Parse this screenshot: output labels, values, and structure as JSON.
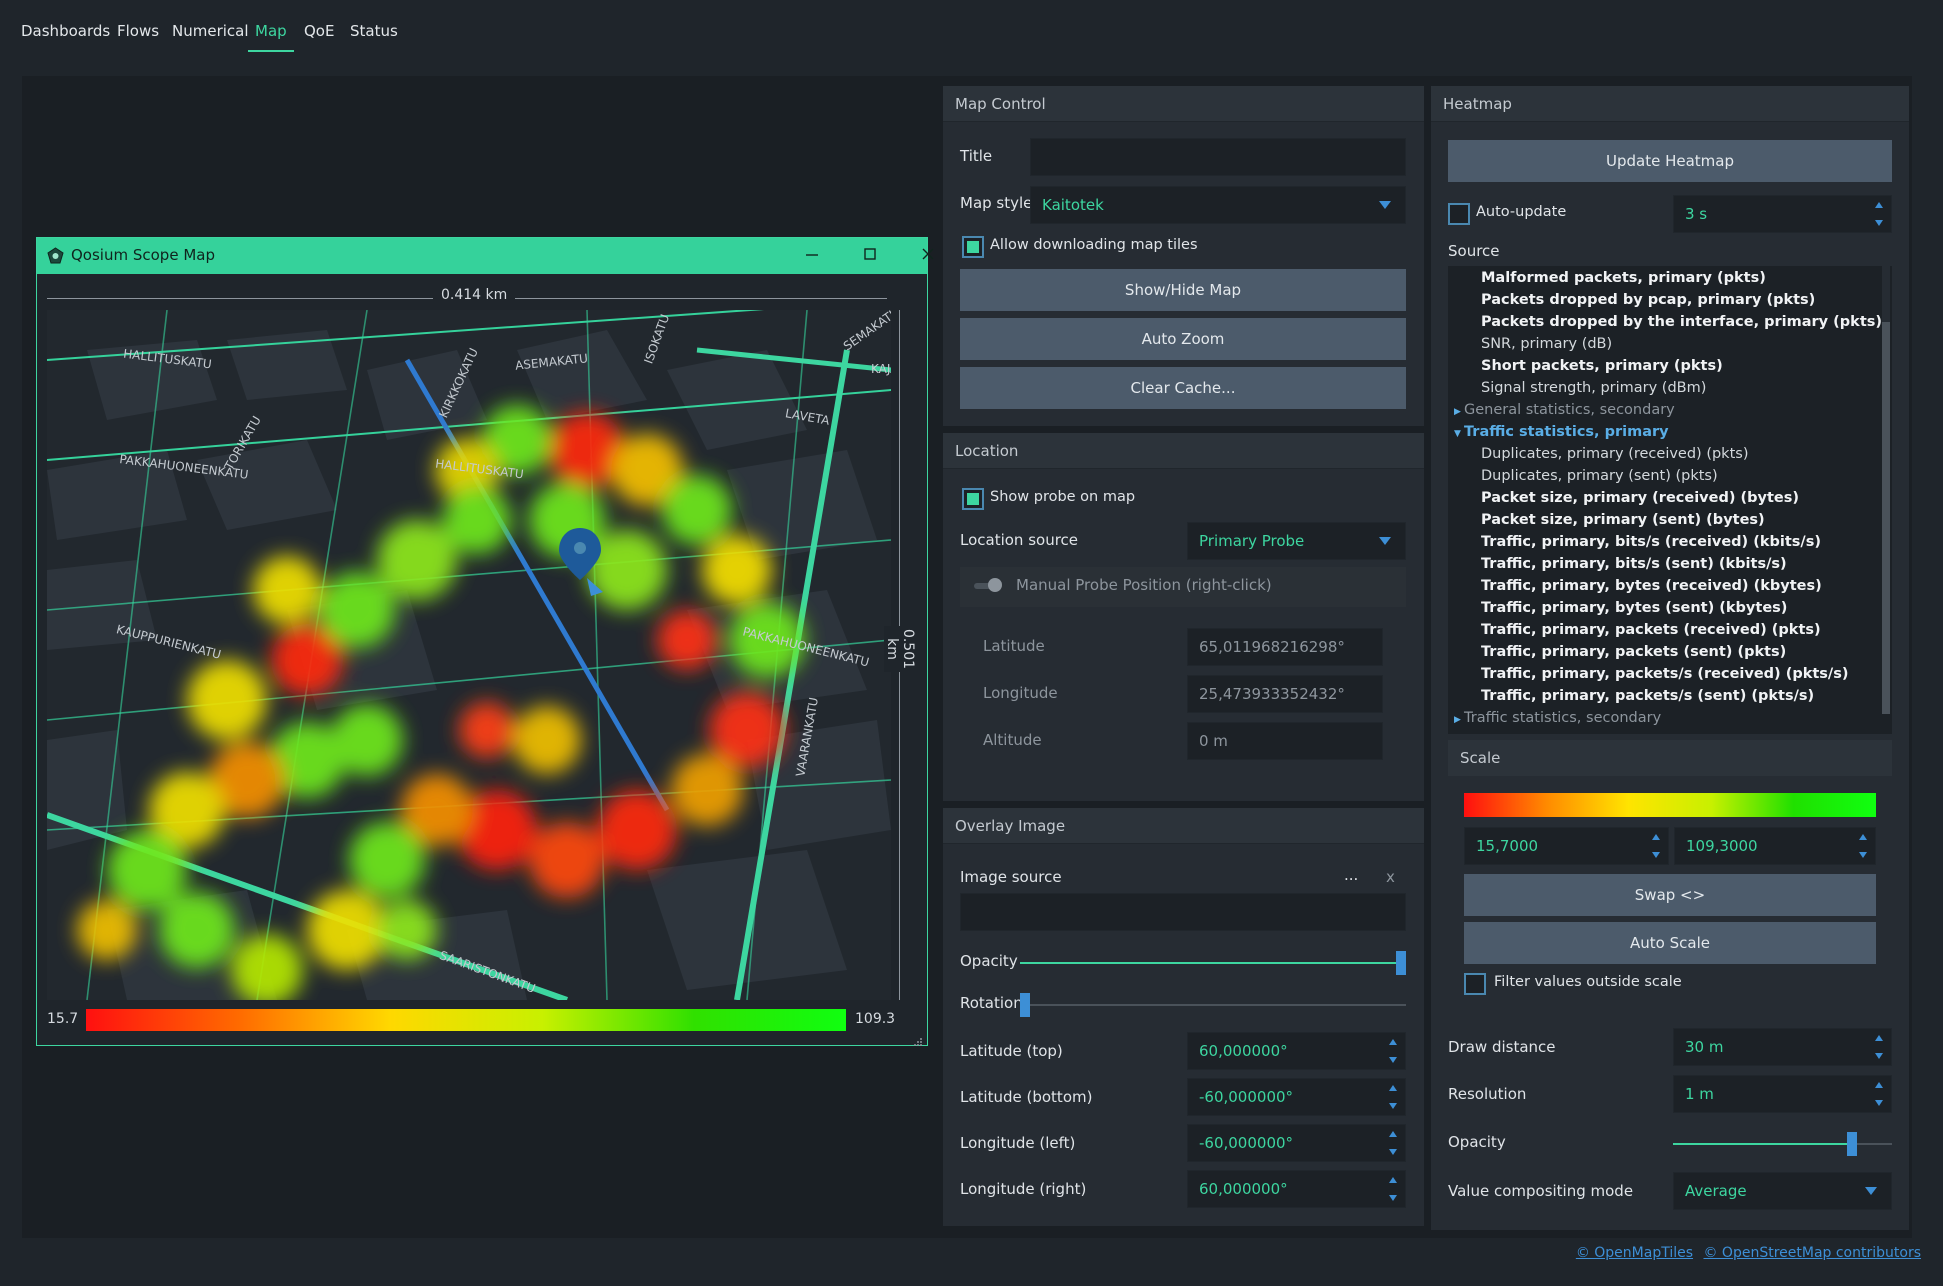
{
  "nav": {
    "tabs": [
      "Dashboards",
      "Flows",
      "Numerical",
      "Map",
      "QoE",
      "Status"
    ],
    "active": "Map"
  },
  "map_window": {
    "title": "Qosium Scope Map",
    "scale_horizontal": "0.414 km",
    "scale_vertical": "0.501 km",
    "legend_min": "15.7",
    "legend_max": "109.3",
    "street_labels": [
      "HALLITUSKATU",
      "ASEMAKATU",
      "KIRKKOKATU",
      "ISOKATU",
      "TORIKATU",
      "PAKKAHUONEENKATU",
      "HALLITUSKATU",
      "ASEMAKATU",
      "KAUPPURIENKATU",
      "PAKKAHUONEENKATU",
      "VAARANKATU",
      "SAARISTONKATU",
      "KAJA",
      "LAVETA",
      "SEMAKATU"
    ]
  },
  "map_control": {
    "header": "Map Control",
    "title_label": "Title",
    "title_value": "",
    "map_style_label": "Map style",
    "map_style_value": "Kaitotek",
    "allow_tiles_label": "Allow downloading map tiles",
    "allow_tiles_checked": true,
    "show_hide_button": "Show/Hide Map",
    "auto_zoom_button": "Auto Zoom",
    "clear_cache_button": "Clear Cache..."
  },
  "location": {
    "header": "Location",
    "show_probe_label": "Show probe on map",
    "show_probe_checked": true,
    "source_label": "Location source",
    "source_value": "Primary Probe",
    "manual_label": "Manual Probe Position (right-click)",
    "latitude_label": "Latitude",
    "latitude_value": "65,011968216298°",
    "longitude_label": "Longitude",
    "longitude_value": "25,473933352432°",
    "altitude_label": "Altitude",
    "altitude_value": "0 m"
  },
  "overlay": {
    "header": "Overlay Image",
    "image_source_label": "Image source",
    "browse_label": "...",
    "clear_label": "x",
    "image_source_value": "",
    "opacity_label": "Opacity",
    "opacity_value": 1.0,
    "rotation_label": "Rotation",
    "rotation_value": 0.0,
    "lat_top_label": "Latitude (top)",
    "lat_top_value": "60,000000°",
    "lat_bottom_label": "Latitude (bottom)",
    "lat_bottom_value": "-60,000000°",
    "lon_left_label": "Longitude (left)",
    "lon_left_value": "-60,000000°",
    "lon_right_label": "Longitude (right)",
    "lon_right_value": "60,000000°"
  },
  "heatmap": {
    "header": "Heatmap",
    "update_button": "Update Heatmap",
    "auto_update_label": "Auto-update",
    "auto_update_checked": false,
    "auto_update_interval": "3 s",
    "source_label": "Source",
    "source_items": [
      {
        "text": "Malformed packets, primary (pkts)",
        "style": "bold"
      },
      {
        "text": "Packets dropped by pcap, primary (pkts)",
        "style": "bold"
      },
      {
        "text": "Packets dropped by the interface, primary (pkts)",
        "style": "bold"
      },
      {
        "text": "SNR, primary (dB)",
        "style": "normal"
      },
      {
        "text": "Short packets, primary (pkts)",
        "style": "bold"
      },
      {
        "text": "Signal strength, primary (dBm)",
        "style": "normal"
      },
      {
        "text": "General statistics, secondary",
        "style": "group"
      },
      {
        "text": "Traffic statistics, primary",
        "style": "group-open"
      },
      {
        "text": "Duplicates, primary (received) (pkts)",
        "style": "normal"
      },
      {
        "text": "Duplicates, primary (sent) (pkts)",
        "style": "normal"
      },
      {
        "text": "Packet size, primary (received) (bytes)",
        "style": "bold"
      },
      {
        "text": "Packet size, primary (sent) (bytes)",
        "style": "bold"
      },
      {
        "text": "Traffic, primary, bits/s (received) (kbits/s)",
        "style": "bold"
      },
      {
        "text": "Traffic, primary, bits/s (sent) (kbits/s)",
        "style": "bold"
      },
      {
        "text": "Traffic, primary, bytes (received) (kbytes)",
        "style": "bold"
      },
      {
        "text": "Traffic, primary, bytes (sent) (kbytes)",
        "style": "bold"
      },
      {
        "text": "Traffic, primary, packets (received) (pkts)",
        "style": "bold"
      },
      {
        "text": "Traffic, primary, packets (sent) (pkts)",
        "style": "bold"
      },
      {
        "text": "Traffic, primary, packets/s (received) (pkts/s)",
        "style": "bold"
      },
      {
        "text": "Traffic, primary, packets/s (sent) (pkts/s)",
        "style": "bold"
      },
      {
        "text": "Traffic statistics, secondary",
        "style": "group"
      }
    ],
    "scale_header": "Scale",
    "scale_min": "15,7000",
    "scale_max": "109,3000",
    "swap_button": "Swap <>",
    "auto_scale_button": "Auto Scale",
    "filter_label": "Filter values outside scale",
    "filter_checked": false,
    "draw_distance_label": "Draw distance",
    "draw_distance_value": "30 m",
    "resolution_label": "Resolution",
    "resolution_value": "1 m",
    "opacity_label": "Opacity",
    "opacity_value": 0.9,
    "compositing_label": "Value compositing mode",
    "compositing_value": "Average"
  },
  "footer": {
    "link1": "© OpenMapTiles",
    "link2": "© OpenStreetMap contributors"
  },
  "colors": {
    "accent": "#3dd6a0",
    "blue": "#3d8fd6",
    "background": "#1f252b",
    "panel": "#262c33",
    "button": "#4c5b6b"
  }
}
